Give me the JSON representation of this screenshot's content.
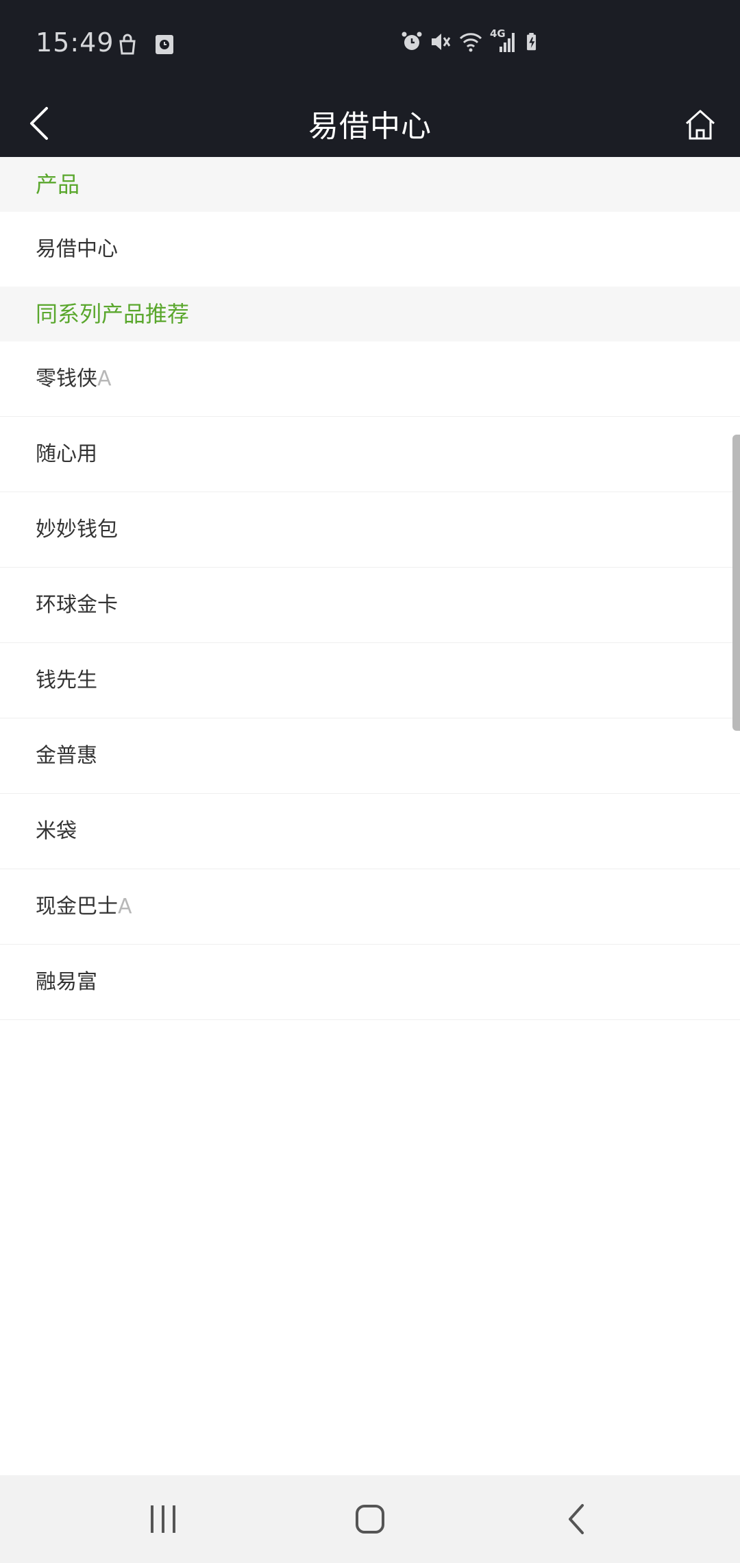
{
  "status_bar": {
    "time": "15:49",
    "network": "4G",
    "icons": [
      "bag-icon",
      "clock-app-icon",
      "alarm-icon",
      "mute-icon",
      "wifi-icon",
      "signal-icon",
      "battery-charging-icon"
    ]
  },
  "header": {
    "title": "易借中心",
    "back_icon": "chevron-left-icon",
    "home_icon": "home-icon"
  },
  "sections": [
    {
      "title": "产品",
      "items": [
        {
          "label": "易借中心",
          "suffix": ""
        }
      ]
    },
    {
      "title": "同系列产品推荐",
      "items": [
        {
          "label": "零钱侠",
          "suffix": "A"
        },
        {
          "label": "随心用",
          "suffix": ""
        },
        {
          "label": "妙妙钱包",
          "suffix": ""
        },
        {
          "label": "环球金卡",
          "suffix": ""
        },
        {
          "label": "钱先生",
          "suffix": ""
        },
        {
          "label": "金普惠",
          "suffix": ""
        },
        {
          "label": "米袋",
          "suffix": ""
        },
        {
          "label": "现金巴士",
          "suffix": "A"
        },
        {
          "label": "融易富",
          "suffix": ""
        }
      ]
    }
  ],
  "nav_bar": {
    "icons": [
      "recents-icon",
      "home-nav-icon",
      "back-nav-icon"
    ]
  },
  "colors": {
    "header_bg": "#1b1d24",
    "accent_green": "#5aa72d",
    "section_bg": "#f6f6f6",
    "text": "#333333"
  }
}
